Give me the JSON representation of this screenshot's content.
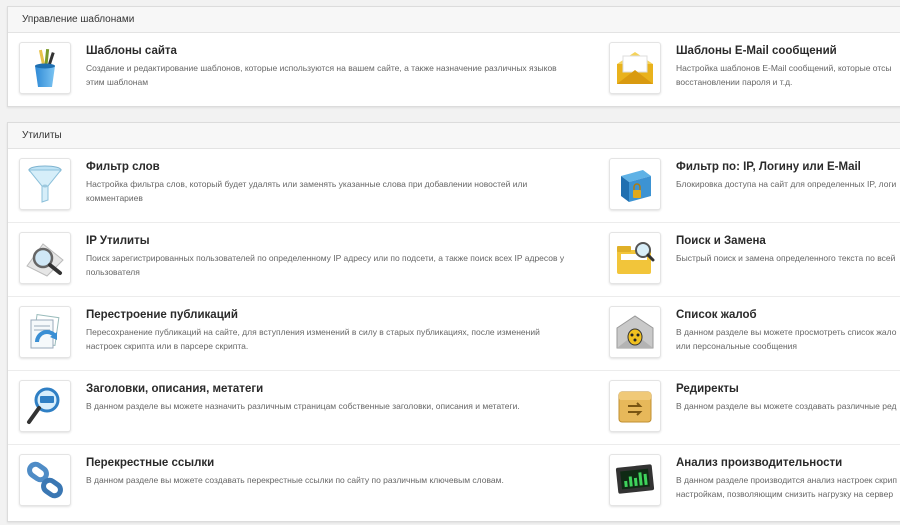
{
  "templates_panel": {
    "header": "Управление шаблонами",
    "items": [
      {
        "title": "Шаблоны сайта",
        "desc": "Создание и редактирование шаблонов, которые используются на вашем сайте, а также назначение различных языков этим шаблонам",
        "icon": "brushes-cup-icon"
      },
      {
        "title": "Шаблоны E-Mail сообщений",
        "desc_line1": "Настройка шаблонов E-Mail сообщений, которые отсы",
        "desc_line2": "восстановлении пароля и т.д.",
        "icon": "envelope-icon"
      }
    ]
  },
  "utilities_panel": {
    "header": "Утилиты",
    "rows": [
      {
        "left": {
          "title": "Фильтр слов",
          "desc": "Настройка фильтра слов, который будет удалять или заменять указанные слова при добавлении новостей или комментариев",
          "icon": "funnel-icon"
        },
        "right": {
          "title": "Фильтр по: IP, Логину или E-Mail",
          "desc_line1": "Блокировка доступа на сайт для определенных IP, логи",
          "desc_line2": "",
          "icon": "locked-box-icon"
        }
      },
      {
        "left": {
          "title": "IP Утилиты",
          "desc": "Поиск зарегистрированных пользователей по определенному IP адресу или по подсети, а также поиск всех IP адресов у пользователя",
          "icon": "magnifier-icon"
        },
        "right": {
          "title": "Поиск и Замена",
          "desc_line1": "Быстрый поиск и замена определенного текста по всей",
          "desc_line2": "",
          "icon": "folder-search-icon"
        }
      },
      {
        "left": {
          "title": "Перестроение публикаций",
          "desc": "Пересохранение публикаций на сайте, для вступления изменений в силу в старых публикациях, после изменений настроек скрипта или в парсере скрипта.",
          "icon": "documents-refresh-icon"
        },
        "right": {
          "title": "Список жалоб",
          "desc_line1": "В данном разделе вы можете просмотреть список жало",
          "desc_line2": "или персональные сообщения",
          "icon": "bug-envelope-icon"
        }
      },
      {
        "left": {
          "title": "Заголовки, описания, метатеги",
          "desc": "В данном разделе вы можете назначить различным страницам собственные заголовки, описания и метатеги.",
          "icon": "keyword-magnifier-icon"
        },
        "right": {
          "title": "Редиректы",
          "desc_line1": "В данном разделе вы можете создавать различные ред",
          "desc_line2": "",
          "icon": "redirect-folder-icon"
        }
      },
      {
        "left": {
          "title": "Перекрестные ссылки",
          "desc": "В данном разделе вы можете создавать перекрестные ссылки по сайту по различным ключевым словам.",
          "icon": "chain-links-icon"
        },
        "right": {
          "title": "Анализ производительности",
          "desc_line1": "В данном разделе производится анализ настроек скрип",
          "desc_line2": "настройкам, позволяющим снизить нагрузку на сервер",
          "icon": "monitor-chart-icon"
        }
      }
    ]
  }
}
